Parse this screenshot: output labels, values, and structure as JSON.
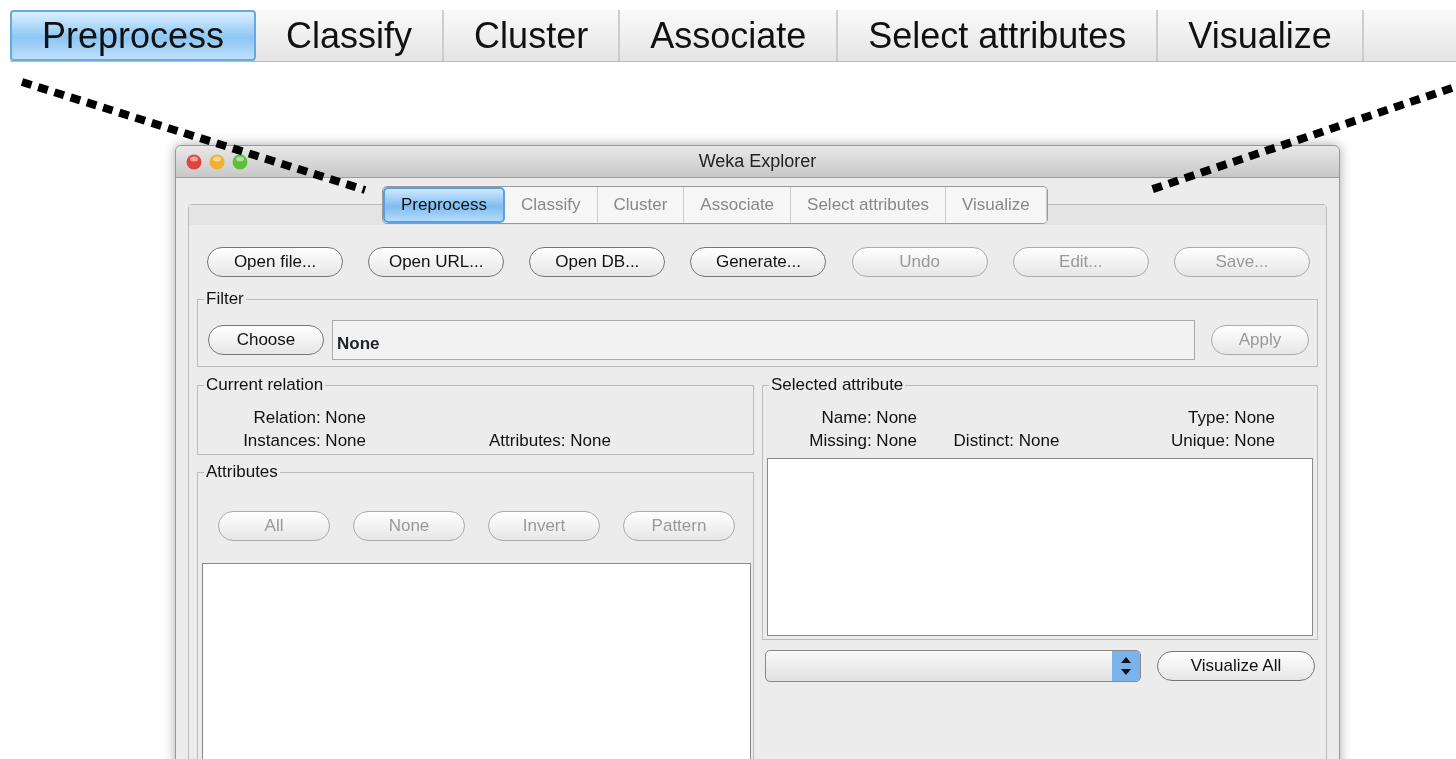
{
  "zoom_tabs": [
    {
      "label": "Preprocess",
      "selected": true
    },
    {
      "label": "Classify",
      "selected": false
    },
    {
      "label": "Cluster",
      "selected": false
    },
    {
      "label": "Associate",
      "selected": false
    },
    {
      "label": "Select attributes",
      "selected": false
    },
    {
      "label": "Visualize",
      "selected": false
    }
  ],
  "window": {
    "title": "Weka Explorer"
  },
  "tabs": [
    {
      "label": "Preprocess",
      "selected": true
    },
    {
      "label": "Classify",
      "selected": false
    },
    {
      "label": "Cluster",
      "selected": false
    },
    {
      "label": "Associate",
      "selected": false
    },
    {
      "label": "Select attributes",
      "selected": false
    },
    {
      "label": "Visualize",
      "selected": false
    }
  ],
  "buttons": [
    {
      "label": "Open file...",
      "disabled": false
    },
    {
      "label": "Open URL...",
      "disabled": false
    },
    {
      "label": "Open DB...",
      "disabled": false
    },
    {
      "label": "Generate...",
      "disabled": false
    },
    {
      "label": "Undo",
      "disabled": true
    },
    {
      "label": "Edit...",
      "disabled": true
    },
    {
      "label": "Save...",
      "disabled": true
    }
  ],
  "filter": {
    "title": "Filter",
    "choose": {
      "label": "Choose",
      "disabled": false
    },
    "value": "None",
    "apply": {
      "label": "Apply",
      "disabled": true
    }
  },
  "current_relation": {
    "title": "Current relation",
    "relation": "Relation: None",
    "instances": "Instances: None",
    "attributes": "Attributes: None"
  },
  "attributes": {
    "title": "Attributes",
    "buttons": [
      {
        "label": "All",
        "disabled": true
      },
      {
        "label": "None",
        "disabled": true
      },
      {
        "label": "Invert",
        "disabled": true
      },
      {
        "label": "Pattern",
        "disabled": true
      }
    ]
  },
  "selected_attribute": {
    "title": "Selected attribute",
    "name": "Name: None",
    "type": "Type: None",
    "missing": "Missing: None",
    "distinct": "Distinct: None",
    "unique": "Unique: None"
  },
  "visualize_all": {
    "label": "Visualize All",
    "disabled": false
  }
}
